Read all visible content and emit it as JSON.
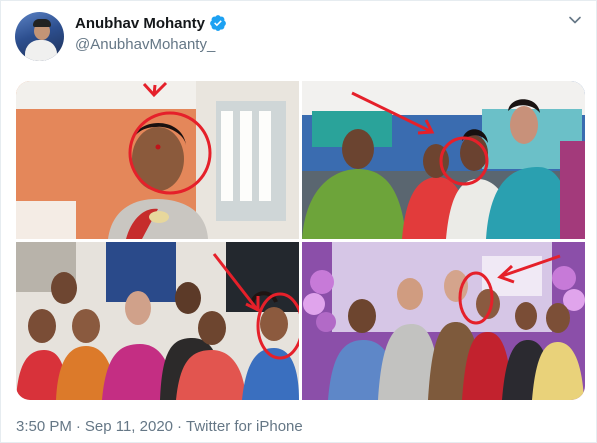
{
  "author": {
    "display_name": "Anubhav Mohanty",
    "handle": "@AnubhavMohanty_",
    "verified": true
  },
  "icons": {
    "verified": "verified-badge-icon",
    "caret": "chevron-down-icon"
  },
  "media": {
    "photos": [
      "photo-portrait-with-red-circle",
      "photo-group-event-with-red-circle",
      "photo-group-selfie-with-red-circle",
      "photo-stage-group-with-red-circle"
    ]
  },
  "meta": {
    "time": "3:50 PM",
    "date": "Sep 11, 2020",
    "separator": "·",
    "source": "Twitter for iPhone"
  },
  "colors": {
    "text_primary": "#14171a",
    "text_secondary": "#657786",
    "verified_blue": "#1da1f2",
    "annotation_red": "#e5202a"
  }
}
